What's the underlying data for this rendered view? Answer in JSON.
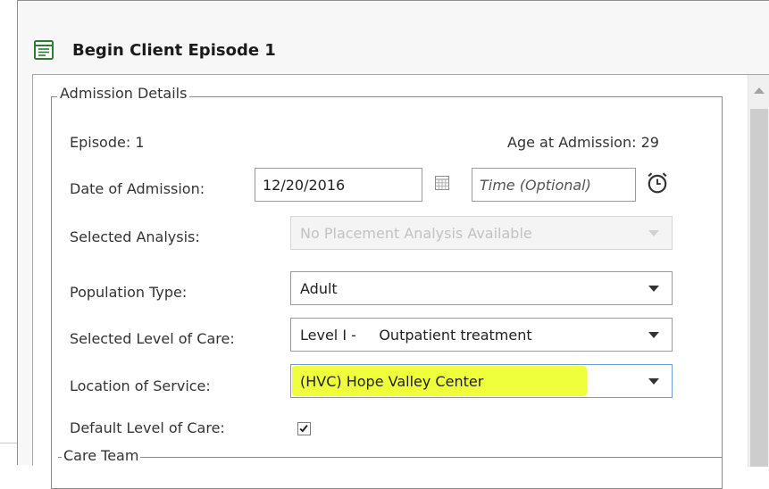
{
  "window": {
    "title": "Begin Client Episode 1",
    "icon": "form-document-icon",
    "accent_color": "#2e7d32"
  },
  "admission": {
    "group_title": "Admission Details",
    "episode_label": "Episode: 1",
    "age_label": "Age at Admission: 29",
    "date_label": "Date of Admission:",
    "date_value": "12/20/2016",
    "time_placeholder": "Time (Optional)",
    "analysis_label": "Selected Analysis:",
    "analysis_value": "No Placement Analysis Available",
    "population_label": "Population Type:",
    "population_value": "Adult",
    "level_label": "Selected Level of Care:",
    "level_value": "Level I -     Outpatient treatment",
    "location_label": "Location of Service:",
    "location_value": "(HVC) Hope Valley Center",
    "default_level_label": "Default Level of Care:",
    "default_level_checked": true,
    "highlight_color": "#eeff2a"
  },
  "care_team": {
    "title": "Care Team"
  }
}
